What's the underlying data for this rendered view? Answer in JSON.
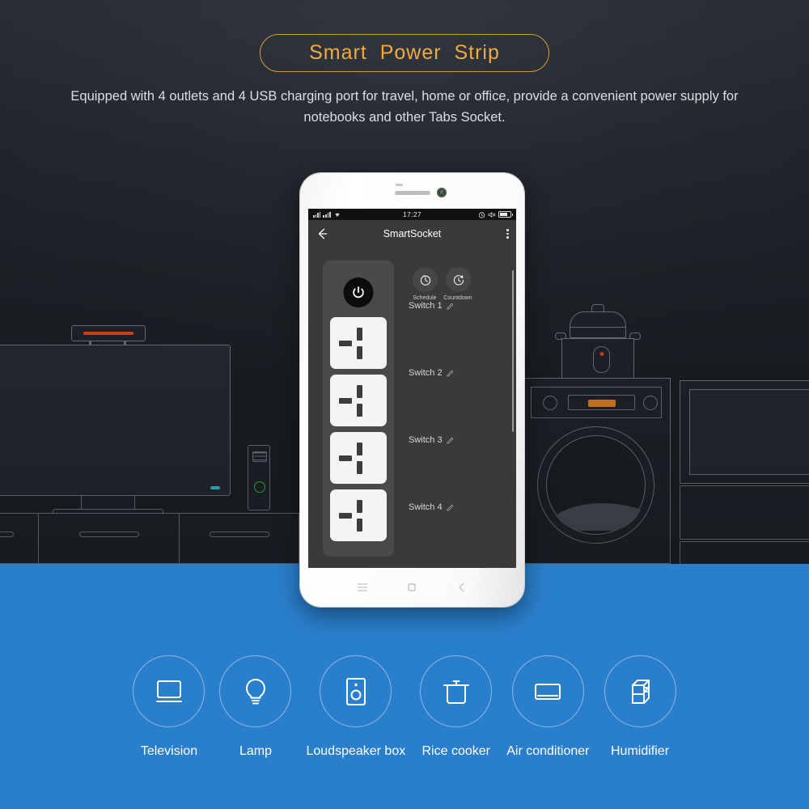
{
  "header": {
    "title": "Smart  Power  Strip",
    "subtitle": "Equipped with 4 outlets and 4 USB charging port for travel, home or office, provide a convenient power supply for notebooks and other Tabs Socket.",
    "title_color": "#f0ab3c",
    "border_color": "#d79a33"
  },
  "background": {
    "scene_color": "#23272e",
    "outline_color": "#6e757e",
    "items": [
      {
        "name": "television",
        "accent": "#1ec8d4"
      },
      {
        "name": "soundbar",
        "accent": "#e34a17"
      },
      {
        "name": "pc-tower",
        "accent": "#2fbf4a"
      },
      {
        "name": "media-cabinet",
        "accent": ""
      },
      {
        "name": "rice-cooker",
        "accent": "#e3401c"
      },
      {
        "name": "washing-machine",
        "accent": "#e58420"
      },
      {
        "name": "microwave",
        "accent": "#1ec8d4"
      }
    ]
  },
  "phone": {
    "status_bar": {
      "time": "17:27",
      "signal_icon": "signal-bars-icon",
      "wifi_icon": "wifi-icon",
      "alarm_icon": "alarm-icon",
      "mute_icon": "mute-icon",
      "battery_icon": "battery-icon"
    },
    "app_bar": {
      "back_icon": "back-arrow-icon",
      "title": "SmartSocket",
      "overflow_icon": "overflow-menu-icon"
    },
    "controls": {
      "power_icon": "power-icon",
      "schedule_icon": "schedule-clock-icon",
      "schedule_label": "Schedule",
      "countdown_icon": "countdown-timer-icon",
      "countdown_label": "Countdown"
    },
    "switches": [
      {
        "label": "Switch 1",
        "edit_icon": "edit-pencil-icon"
      },
      {
        "label": "Switch 2",
        "edit_icon": "edit-pencil-icon"
      },
      {
        "label": "Switch 3",
        "edit_icon": "edit-pencil-icon"
      },
      {
        "label": "Switch 4",
        "edit_icon": "edit-pencil-icon"
      }
    ],
    "nav": [
      {
        "name": "menu-button",
        "icon": "menu-icon"
      },
      {
        "name": "home-button",
        "icon": "home-square-icon"
      },
      {
        "name": "back-button",
        "icon": "chevron-left-icon"
      }
    ]
  },
  "features": {
    "background_color": "#2a7fcc",
    "items": [
      {
        "label": "Television",
        "icon": "television-icon"
      },
      {
        "label": "Lamp",
        "icon": "lightbulb-icon"
      },
      {
        "label": "Loudspeaker box",
        "icon": "loudspeaker-icon"
      },
      {
        "label": "Rice cooker",
        "icon": "rice-cooker-icon"
      },
      {
        "label": "Air conditioner",
        "icon": "air-conditioner-icon"
      },
      {
        "label": "Humidifier",
        "icon": "humidifier-icon"
      }
    ]
  }
}
